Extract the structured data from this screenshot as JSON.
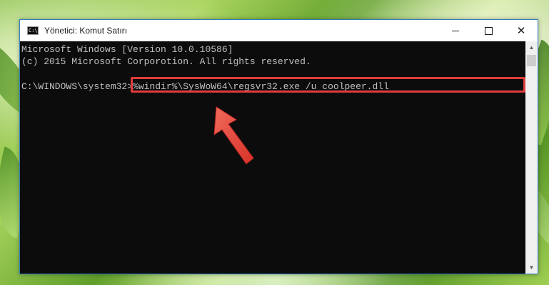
{
  "window": {
    "title": "Yönetici: Komut Satırı",
    "app_icon_text": "C:\\."
  },
  "console": {
    "lines": [
      "Microsoft Windows [Version 10.0.10586]",
      "(c) 2015 Microsoft Corporotion. All rights reserved."
    ],
    "prompt": "C:\\WINDOWS\\system32>",
    "command": "%windir%\\SysWoW64\\regsvr32.exe /u coolpeer.dll"
  },
  "colors": {
    "console_background": "#0c0c0c",
    "console_text": "#c0c0c0",
    "highlight": "#e23b3b",
    "window_border": "#2f7fbf"
  },
  "icons": {
    "minimize": "minimize-icon",
    "maximize": "maximize-icon",
    "close": "close-icon",
    "arrow": "red-arrow-icon"
  }
}
